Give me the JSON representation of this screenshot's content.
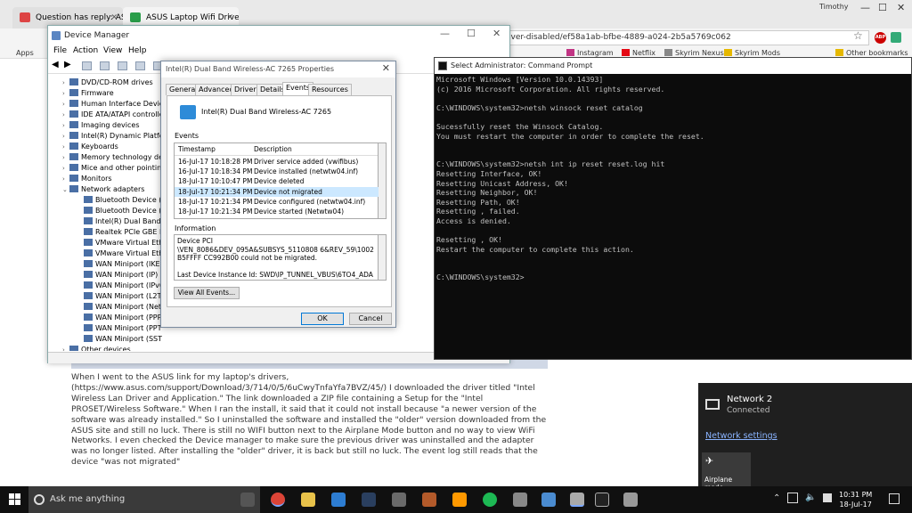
{
  "browser": {
    "tabs": [
      {
        "title": "Question has reply: ASU"
      },
      {
        "title": "ASUS Laptop Wifi Driver"
      }
    ],
    "profile_name": "Timothy",
    "address": "iver-disabled/ef58a1ab-bfbe-4889-a024-2b5a5769c062",
    "bookmarks": [
      "Apps",
      "Instagram",
      "Netflix",
      "Skyrim Nexus",
      "Skyrim Mods",
      "Other bookmarks"
    ]
  },
  "device_manager": {
    "title": "Device Manager",
    "menu": [
      "File",
      "Action",
      "View",
      "Help"
    ],
    "tree": [
      {
        "label": "DVD/CD-ROM drives",
        "level": 0
      },
      {
        "label": "Firmware",
        "level": 0
      },
      {
        "label": "Human Interface Devic",
        "level": 0
      },
      {
        "label": "IDE ATA/ATAPI controlle",
        "level": 0
      },
      {
        "label": "Imaging devices",
        "level": 0
      },
      {
        "label": "Intel(R) Dynamic Platfor",
        "level": 0
      },
      {
        "label": "Keyboards",
        "level": 0
      },
      {
        "label": "Memory technology de",
        "level": 0
      },
      {
        "label": "Mice and other pointin",
        "level": 0
      },
      {
        "label": "Monitors",
        "level": 0
      },
      {
        "label": "Network adapters",
        "level": 0,
        "expanded": true
      },
      {
        "label": "Bluetooth Device (P",
        "level": 1
      },
      {
        "label": "Bluetooth Device (R",
        "level": 1
      },
      {
        "label": "Intel(R) Dual Band W",
        "level": 1
      },
      {
        "label": "Realtek PCIe GBE Fa",
        "level": 1
      },
      {
        "label": "VMware Virtual Ethe",
        "level": 1
      },
      {
        "label": "VMware Virtual Ethe",
        "level": 1
      },
      {
        "label": "WAN Miniport (IKEv",
        "level": 1
      },
      {
        "label": "WAN Miniport (IP)",
        "level": 1
      },
      {
        "label": "WAN Miniport (IPv6",
        "level": 1
      },
      {
        "label": "WAN Miniport (L2TP",
        "level": 1
      },
      {
        "label": "WAN Miniport (Netw",
        "level": 1
      },
      {
        "label": "WAN Miniport (PPP",
        "level": 1
      },
      {
        "label": "WAN Miniport (PPTP",
        "level": 1
      },
      {
        "label": "WAN Miniport (SSTP)",
        "level": 1
      },
      {
        "label": "Other devices",
        "level": 0
      }
    ]
  },
  "properties": {
    "title": "Intel(R) Dual Band Wireless-AC 7265 Properties",
    "tabs": [
      "General",
      "Advanced",
      "Driver",
      "Details",
      "Events",
      "Resources"
    ],
    "active_tab": "Events",
    "device_name": "Intel(R) Dual Band Wireless-AC 7265",
    "events_label": "Events",
    "columns": [
      "Timestamp",
      "Description"
    ],
    "events": [
      {
        "timestamp": "16-Jul-17 10:18:28 PM",
        "description": "Driver service added (vwifibus)"
      },
      {
        "timestamp": "16-Jul-17 10:18:34 PM",
        "description": "Device installed (netwtw04.inf)"
      },
      {
        "timestamp": "18-Jul-17 10:10:47 PM",
        "description": "Device deleted"
      },
      {
        "timestamp": "18-Jul-17 10:21:34 PM",
        "description": "Device not migrated",
        "selected": true
      },
      {
        "timestamp": "18-Jul-17 10:21:34 PM",
        "description": "Device configured (netwtw04.inf)"
      },
      {
        "timestamp": "18-Jul-17 10:21:34 PM",
        "description": "Device started (Netwtw04)"
      }
    ],
    "information_label": "Information",
    "information": "Device PCI\n\\VEN_8086&DEV_095A&SUBSYS_5110808 6&REV_59\\1002B5FFFF CC992B00 could not be migrated.\n\nLast Device Instance Id: SWD\\IP_TUNNEL_VBUS\\6TO4_ADAPTER",
    "view_all_label": "View All Events...",
    "ok_label": "OK",
    "cancel_label": "Cancel"
  },
  "cmd": {
    "title": "Select Administrator: Command Prompt",
    "lines": [
      "Microsoft Windows [Version 10.0.14393]",
      "(c) 2016 Microsoft Corporation. All rights reserved.",
      "",
      "C:\\WINDOWS\\system32>netsh winsock reset catalog",
      "",
      "Sucessfully reset the Winsock Catalog.",
      "You must restart the computer in order to complete the reset.",
      "",
      "",
      "C:\\WINDOWS\\system32>netsh int ip reset reset.log hit",
      "Resetting Interface, OK!",
      "Resetting Unicast Address, OK!",
      "Resetting Neighbor, OK!",
      "Resetting Path, OK!",
      "Resetting , failed.",
      "Access is denied.",
      "",
      "Resetting , OK!",
      "Restart the computer to complete this action.",
      "",
      "",
      "C:\\WINDOWS\\system32>"
    ]
  },
  "post_text": "When I went to the ASUS link  for my laptop's drivers, (https://www.asus.com/support/Download/3/714/0/5/6uCwyTnfaYfa7BVZ/45/) I downloaded the driver titled \"Intel Wireless Lan Driver and Application.\" The link downloaded a ZIP file containing a Setup for the \"Intel PROSET/Wireless Software.\" When I ran the install, it said that it could not install because \"a newer version of the software was already installed.\" So I uninstalled the software and installed the \"older\" version downloaded from the ASUS site and still no luck. There is still no WIFI button next to the Airplane Mode button and no way to view WiFi Networks. I even checked the Device manager to make sure the previous driver was uninstalled and the adapter was no longer listed. After installing the \"older\" driver, it is back but still no luck. The event log still reads that the device \"was not migrated\"",
  "network_flyout": {
    "network_name": "Network  2",
    "status": "Connected",
    "settings_link": "Network settings",
    "airplane_label": "Airplane mode"
  },
  "taskbar": {
    "search_placeholder": "Ask me anything",
    "time": "10:31 PM",
    "date": "18-Jul-17"
  }
}
